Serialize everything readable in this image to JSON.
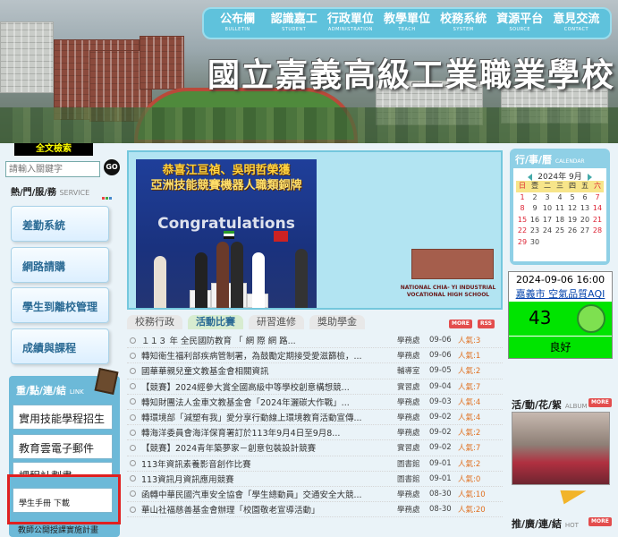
{
  "nav": [
    {
      "zh": "公布欄",
      "en": "BULLETIN"
    },
    {
      "zh": "認識嘉工",
      "en": "STUDENT"
    },
    {
      "zh": "行政單位",
      "en": "ADMINISTRATION"
    },
    {
      "zh": "教學單位",
      "en": "TEACH"
    },
    {
      "zh": "校務系統",
      "en": "SYSTEM"
    },
    {
      "zh": "資源平台",
      "en": "SOURCE"
    },
    {
      "zh": "意見交流",
      "en": "CONTACT"
    }
  ],
  "school_name": "國立嘉義高級工業職業學校",
  "search": {
    "tag": "全文檢索",
    "placeholder": "請輸入關鍵字",
    "go": "GO"
  },
  "service": {
    "title": "熱/門/服/務",
    "en": "SERVICE",
    "items": [
      "差勤系統",
      "網路請購",
      "學生到離校管理",
      "成績與課程"
    ]
  },
  "links": {
    "title": "重/點/連/結",
    "en": "LINK",
    "items": [
      "實用技能學程招生",
      "教育雲電子郵件",
      "課程計劃書",
      "學生手冊 下載",
      "教師公開授課實施計畫"
    ]
  },
  "slide": {
    "headline_1": "恭喜江亘禎、吳明哲榮獲",
    "headline_2": "亞洲技能競賽機器人職類銅牌",
    "banner_text": "Congratulations",
    "caption_1": "NATIONAL CHIA- YI INDUSTRIAL",
    "caption_2": "VOCATIONAL HIGH SCHOOL"
  },
  "tabs": [
    "校務行政",
    "活動比賽",
    "研習進修",
    "獎助學金"
  ],
  "tags": {
    "more": "MORE",
    "rss": "RSS"
  },
  "news": [
    {
      "title": "１１３ 年 全民國防教育 「 網 際 網 路...",
      "dept": "學務處",
      "date": "09-06",
      "pop": "人氣:3"
    },
    {
      "title": "轉知衛生福利部疾病管制署，為鼓勵定期接受愛滋篩檢，...",
      "dept": "學務處",
      "date": "09-06",
      "pop": "人氣:1"
    },
    {
      "title": "國華華親兒童文教基金會相關資訊",
      "dept": "輔導室",
      "date": "09-05",
      "pop": "人氣:2"
    },
    {
      "title": "【競賽】2024經參大賞全國高級中等學校創意構想競...",
      "dept": "實習處",
      "date": "09-04",
      "pop": "人氣:7"
    },
    {
      "title": "轉知財團法人金車文教基金會「2024年灑碳大作戰」...",
      "dept": "學務處",
      "date": "09-03",
      "pop": "人氣:4"
    },
    {
      "title": "轉環境部「減塑有我」愛分享行動線上環境教育活動宣傳...",
      "dept": "學務處",
      "date": "09-02",
      "pop": "人氣:4"
    },
    {
      "title": "轉海洋委員會海洋保育署訂於113年9月4日至9月8...",
      "dept": "學務處",
      "date": "09-02",
      "pop": "人氣:2"
    },
    {
      "title": "【競賽】2024青年築夢家－創意包裝設計競賽",
      "dept": "實習處",
      "date": "09-02",
      "pop": "人氣:7"
    },
    {
      "title": "113年資訊素養影音創作比賽",
      "dept": "圖書館",
      "date": "09-01",
      "pop": "人氣:2"
    },
    {
      "title": "113資訊月資訊應用競賽",
      "dept": "圖書館",
      "date": "09-01",
      "pop": "人氣:0"
    },
    {
      "title": "函轉中華民國汽車安全協會「學生總動員」交通安全大競...",
      "dept": "學務處",
      "date": "08-30",
      "pop": "人氣:10"
    },
    {
      "title": "華山社福慈善基金會辦理「校園敬老宣導活動」",
      "dept": "學務處",
      "date": "08-30",
      "pop": "人氣:20"
    }
  ],
  "calendar": {
    "title": "行/事/曆",
    "en": "CALENDAR",
    "month": "2024年 9月",
    "weekdays": [
      "日",
      "壹",
      "二",
      "三",
      "四",
      "五",
      "六"
    ],
    "days": [
      "1",
      "2",
      "3",
      "4",
      "5",
      "6",
      "7",
      "8",
      "9",
      "10",
      "11",
      "12",
      "13",
      "14",
      "15",
      "16",
      "17",
      "18",
      "19",
      "20",
      "21",
      "22",
      "23",
      "24",
      "25",
      "26",
      "27",
      "28",
      "29",
      "30"
    ]
  },
  "aqi": {
    "time": "2024-09-06 16:00",
    "place": "嘉義市 空氣品質AQI",
    "value": "43",
    "level": "良好",
    "color": "#00e400"
  },
  "album": {
    "title": "活/動/花/絮",
    "en": "ALBUM",
    "more": "MORE"
  },
  "promo": {
    "title": "推/廣/連/結",
    "en": "HOT",
    "more": "MORE"
  },
  "colors": {
    "accent": "#5fc2dc",
    "link_panel": "#6cb9d8",
    "highlight": "#e02020"
  }
}
